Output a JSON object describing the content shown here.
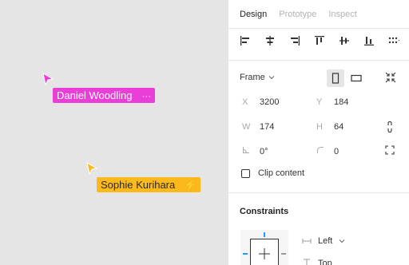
{
  "canvas": {
    "collaborators": [
      {
        "name": "Daniel Woodling",
        "extra": "···",
        "color": "#e93fd8"
      },
      {
        "name": "Sophie Kurihara",
        "extra": "⚡",
        "color": "#fbb91b"
      }
    ]
  },
  "panel": {
    "tabs": [
      {
        "label": "Design",
        "active": true
      },
      {
        "label": "Prototype",
        "active": false
      },
      {
        "label": "Inspect",
        "active": false
      }
    ],
    "frame": {
      "label": "Frame"
    },
    "props": {
      "x_label": "X",
      "x": "3200",
      "y_label": "Y",
      "y": "184",
      "w_label": "W",
      "w": "174",
      "h_label": "H",
      "h": "64",
      "rotation": "0°",
      "radius": "0"
    },
    "clip_content": {
      "label": "Clip content",
      "checked": false
    },
    "constraints": {
      "title": "Constraints",
      "horizontal": "Left",
      "vertical": "Top"
    }
  },
  "colors": {
    "accent": "#18a0fb",
    "pink": "#e93fd8",
    "yellow": "#fbb91b"
  }
}
